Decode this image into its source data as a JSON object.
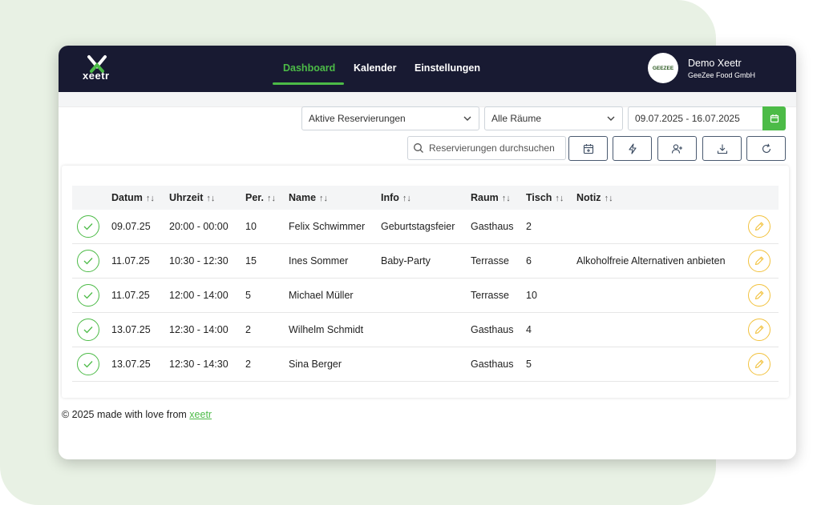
{
  "app": {
    "logo_text": "xeetr",
    "brand_color": "#4cbb47",
    "nav_bg": "#181a32",
    "edit_color": "#f2c23e"
  },
  "nav": {
    "items": [
      {
        "label": "Dashboard",
        "active": true
      },
      {
        "label": "Kalender",
        "active": false
      },
      {
        "label": "Einstellungen",
        "active": false
      }
    ]
  },
  "user": {
    "name": "Demo Xeetr",
    "company": "GeeZee Food GmbH",
    "avatar_text": "GEEZEE"
  },
  "filters": {
    "status": {
      "value": "Aktive Reservierungen"
    },
    "room": {
      "value": "Alle Räume"
    },
    "date_range": {
      "value": "09.07.2025 - 16.07.2025"
    }
  },
  "search": {
    "placeholder": "Reservierungen durchsuchen"
  },
  "toolbar": {
    "icons": [
      "calendar-add-icon",
      "lightning-icon",
      "user-add-icon",
      "download-icon",
      "refresh-icon"
    ]
  },
  "table": {
    "headers": [
      "Datum",
      "Uhrzeit",
      "Per.",
      "Name",
      "Info",
      "Raum",
      "Tisch",
      "Notiz"
    ],
    "sort_glyph": "↑↓",
    "rows": [
      {
        "date": "09.07.25",
        "time": "20:00 - 00:00",
        "persons": "10",
        "name": "Felix Schwimmer",
        "info": "Geburtstagsfeier",
        "room": "Gasthaus",
        "table": "2",
        "note": ""
      },
      {
        "date": "11.07.25",
        "time": "10:30 - 12:30",
        "persons": "15",
        "name": "Ines Sommer",
        "info": "Baby-Party",
        "room": "Terrasse",
        "table": "6",
        "note": "Alkoholfreie Alternativen anbieten"
      },
      {
        "date": "11.07.25",
        "time": "12:00 - 14:00",
        "persons": "5",
        "name": "Michael Müller",
        "info": "",
        "room": "Terrasse",
        "table": "10",
        "note": ""
      },
      {
        "date": "13.07.25",
        "time": "12:30 - 14:00",
        "persons": "2",
        "name": "Wilhelm Schmidt",
        "info": "",
        "room": "Gasthaus",
        "table": "4",
        "note": ""
      },
      {
        "date": "13.07.25",
        "time": "12:30 - 14:30",
        "persons": "2",
        "name": "Sina Berger",
        "info": "",
        "room": "Gasthaus",
        "table": "5",
        "note": ""
      }
    ]
  },
  "footer": {
    "text": "© 2025 made with love from ",
    "link": "xeetr"
  }
}
